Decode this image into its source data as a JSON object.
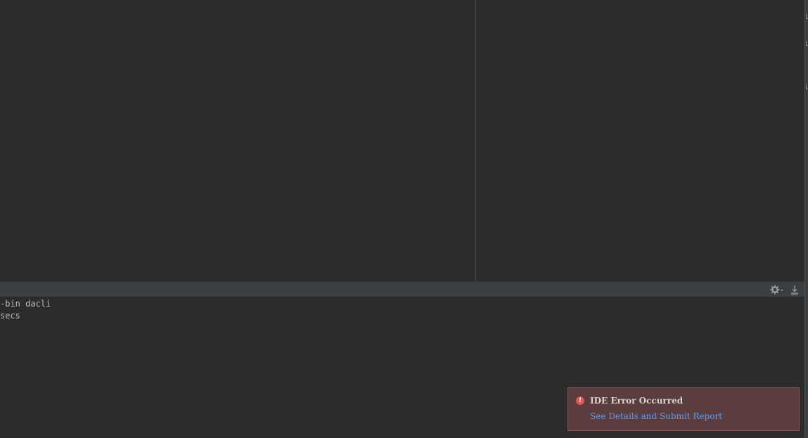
{
  "console": {
    "lines": [
      "-bin dacli",
      "secs"
    ]
  },
  "toolbar": {
    "settings_icon": "gear-icon",
    "hide_icon": "hide-icon"
  },
  "notification": {
    "title": "IDE Error Occurred",
    "link": "See Details and Submit Report",
    "icon": "error-icon"
  },
  "colors": {
    "background": "#2b2b2b",
    "panel_header": "#3c3f41",
    "balloon_bg": "#5b3d40",
    "error": "#e05555",
    "link": "#589df6"
  }
}
